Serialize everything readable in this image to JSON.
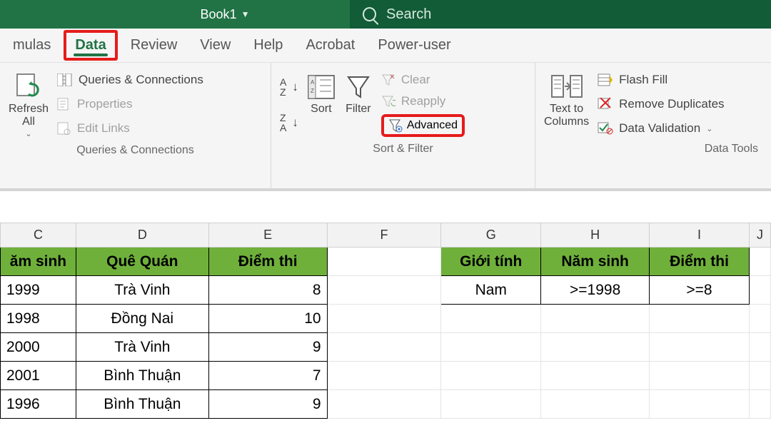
{
  "title": {
    "book": "Book1",
    "search_placeholder": "Search"
  },
  "tabs": {
    "mulas": "mulas",
    "data": "Data",
    "review": "Review",
    "view": "View",
    "help": "Help",
    "acrobat": "Acrobat",
    "poweruser": "Power-user"
  },
  "ribbon": {
    "refresh": "Refresh\nAll",
    "queries": "Queries & Connections",
    "properties": "Properties",
    "editlinks": "Edit Links",
    "group_qc": "Queries & Connections",
    "sort": "Sort",
    "filter": "Filter",
    "clear": "Clear",
    "reapply": "Reapply",
    "advanced": "Advanced",
    "group_sf": "Sort & Filter",
    "texttocol": "Text to\nColumns",
    "flashfill": "Flash Fill",
    "removedup": "Remove Duplicates",
    "datavalid": "Data Validation",
    "group_dt": "Data Tools"
  },
  "cols": {
    "C": "C",
    "D": "D",
    "E": "E",
    "F": "F",
    "G": "G",
    "H": "H",
    "I": "I",
    "J": "J"
  },
  "headers1": {
    "C": "ăm sinh",
    "D": "Quê Quán",
    "E": "Điểm thi"
  },
  "headers2": {
    "G": "Giới tính",
    "H": "Năm sinh",
    "I": "Điểm thi"
  },
  "rows1": [
    {
      "C": "1999",
      "D": "Trà Vinh",
      "E": "8"
    },
    {
      "C": "1998",
      "D": "Đồng Nai",
      "E": "10"
    },
    {
      "C": "2000",
      "D": "Trà Vinh",
      "E": "9"
    },
    {
      "C": "2001",
      "D": "Bình Thuận",
      "E": "7"
    },
    {
      "C": "1996",
      "D": "Bình Thuận",
      "E": "9"
    }
  ],
  "crit": {
    "G": "Nam",
    "H": ">=1998",
    "I": ">=8"
  }
}
